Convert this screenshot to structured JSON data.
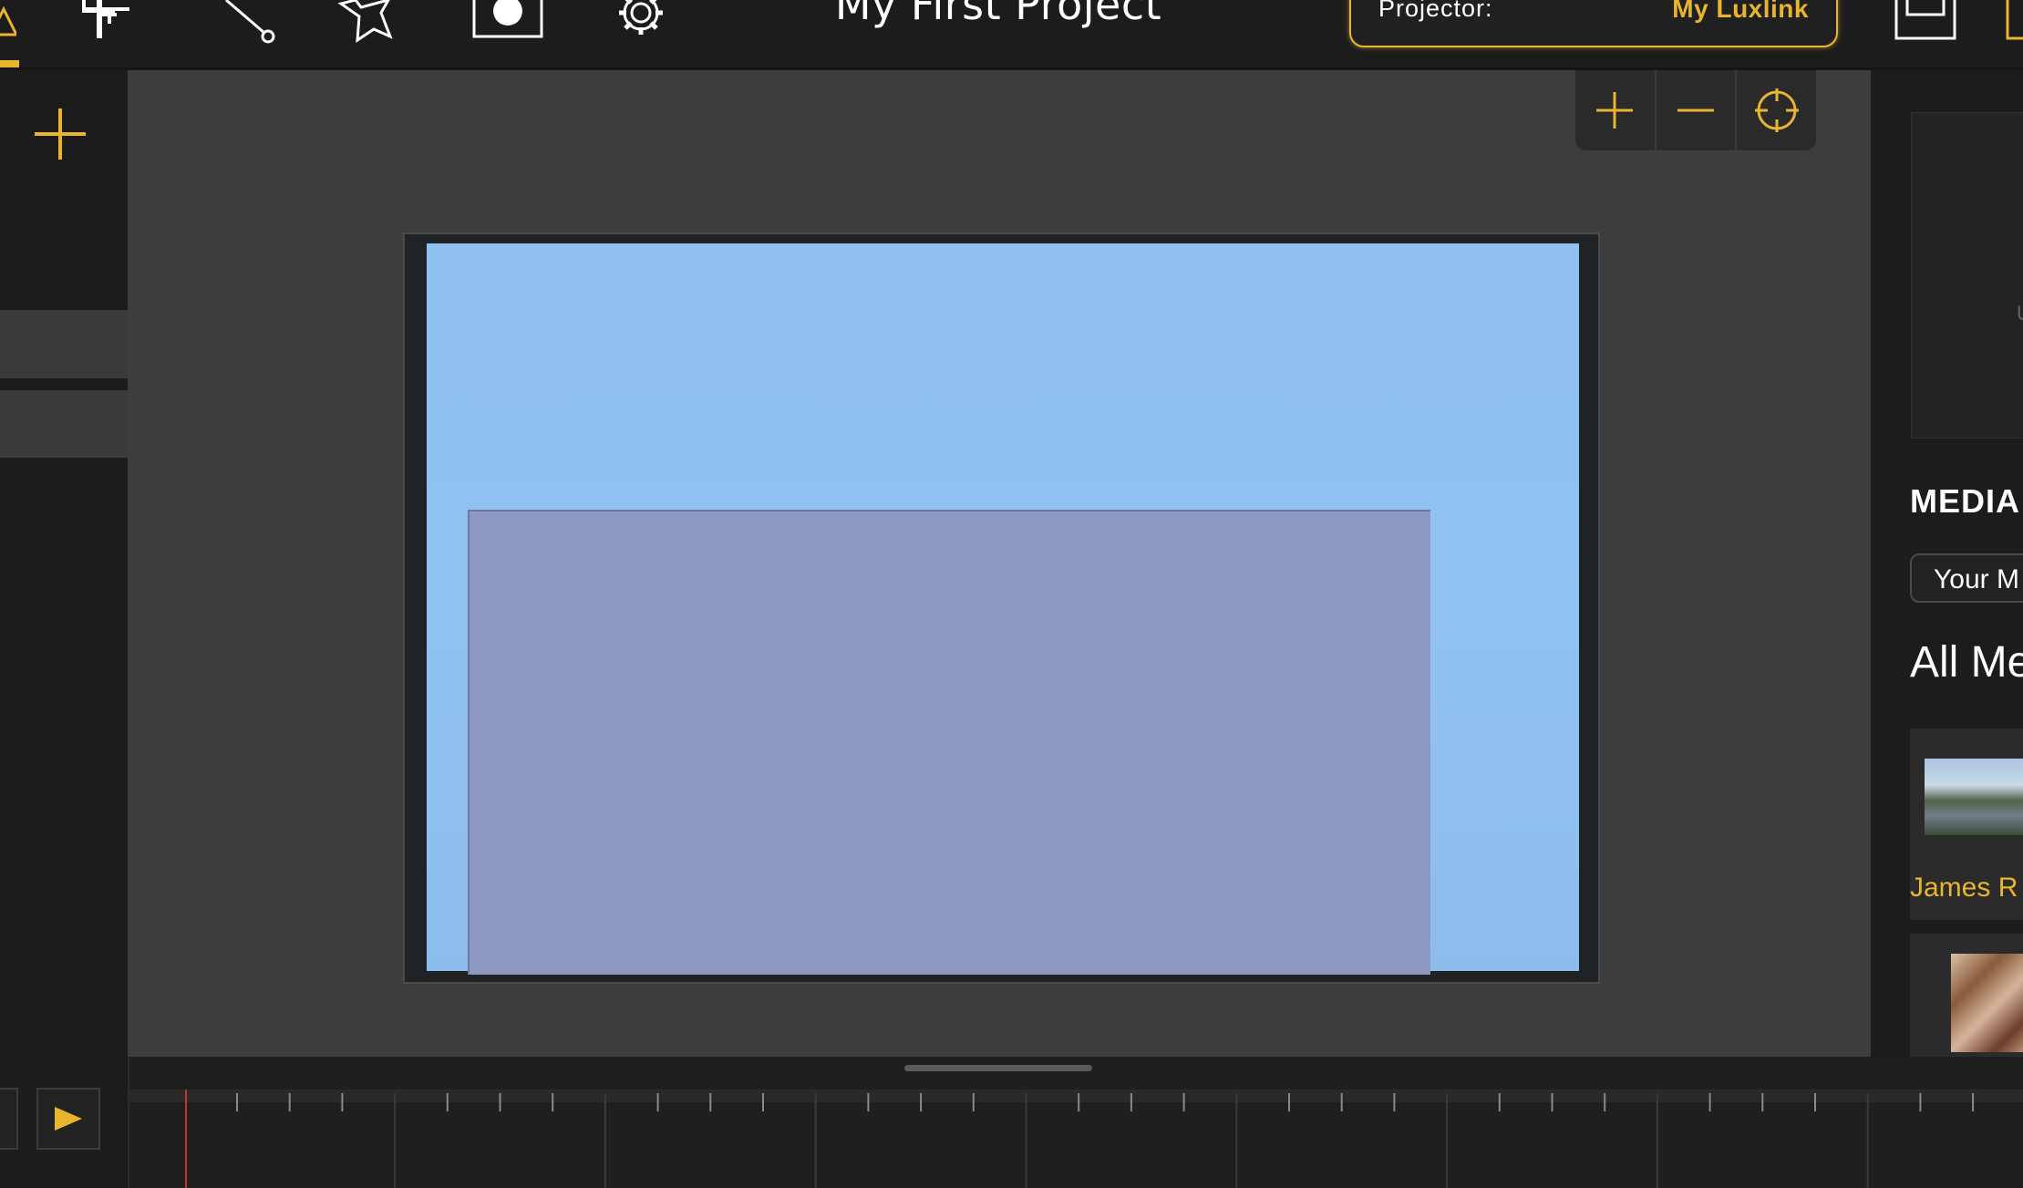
{
  "toolbar": {
    "project_title": "My First Project",
    "projector_label": "Projector:",
    "projector_name": "My Luxlink",
    "icons": [
      "warning-icon",
      "add-text-icon",
      "line-tool-icon",
      "star-icon",
      "record-icon",
      "gear-icon",
      "save-icon"
    ]
  },
  "canvas": {
    "zoom_in": "plus-icon",
    "zoom_out": "minus-icon",
    "recenter": "crosshair-icon"
  },
  "right_panel": {
    "preview_text": "U",
    "media_heading": "MEDIA",
    "your_media_button": "Your M",
    "all_media_heading": "All Me",
    "items": [
      {
        "label": "James R"
      }
    ]
  },
  "colors": {
    "accent": "#e9b52f",
    "panel": "#1c1c1c",
    "canvas": "#3d3d3d",
    "playhead": "#d0312d"
  }
}
